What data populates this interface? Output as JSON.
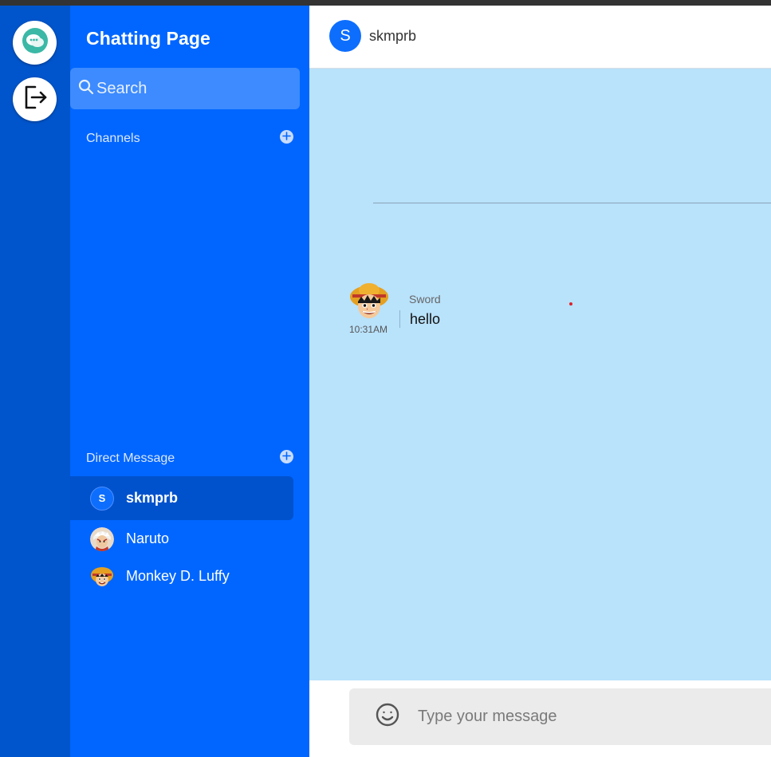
{
  "app": {
    "title": "Chatting Page"
  },
  "rail": {
    "chat_icon": "chat-bubbles-icon",
    "logout_icon": "logout-icon"
  },
  "sidebar": {
    "search_label": "Search",
    "channels_label": "Channels",
    "direct_message_label": "Direct Message",
    "direct_messages": [
      {
        "name": "skmprb",
        "avatar_letter": "S",
        "active": true
      },
      {
        "name": "Naruto",
        "avatar": "naruto-avatar",
        "active": false
      },
      {
        "name": "Monkey D. Luffy",
        "avatar": "luffy-avatar",
        "active": false
      }
    ]
  },
  "chat": {
    "header": {
      "avatar_letter": "S",
      "name": "skmprb"
    },
    "messages": [
      {
        "sender": "Sword",
        "time": "10:31AM",
        "text": "hello",
        "avatar": "luffy-avatar"
      }
    ],
    "composer": {
      "placeholder": "Type your message",
      "emoji_icon": "smiley-icon"
    }
  },
  "colors": {
    "rail": "#0055cc",
    "sidebar": "#0066ff",
    "search": "#3d8bff",
    "active_item": "#0052cc",
    "messages_bg": "#b9e2fb",
    "accent": "#0d6efd"
  }
}
